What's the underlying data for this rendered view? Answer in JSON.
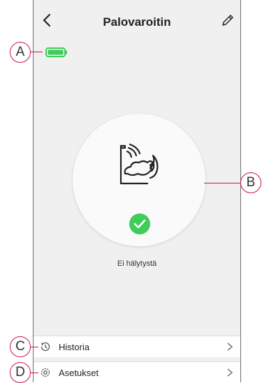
{
  "header": {
    "title": "Palovaroitin",
    "back_icon": "chevron-left-icon",
    "edit_icon": "pencil-icon"
  },
  "battery": {
    "icon": "battery-icon",
    "color": "#3dcd58",
    "level": 1.0
  },
  "device": {
    "icon": "smoke-alarm-icon",
    "status_icon": "checkmark-icon",
    "status_color": "#3dcd58",
    "status_text": "Ei hälytystä"
  },
  "menu": [
    {
      "label": "Historia",
      "icon": "history-icon"
    },
    {
      "label": "Asetukset",
      "icon": "gear-icon"
    }
  ],
  "callouts": {
    "a": "A",
    "b": "B",
    "c": "C",
    "d": "D"
  },
  "accent_color": "#c4184c"
}
